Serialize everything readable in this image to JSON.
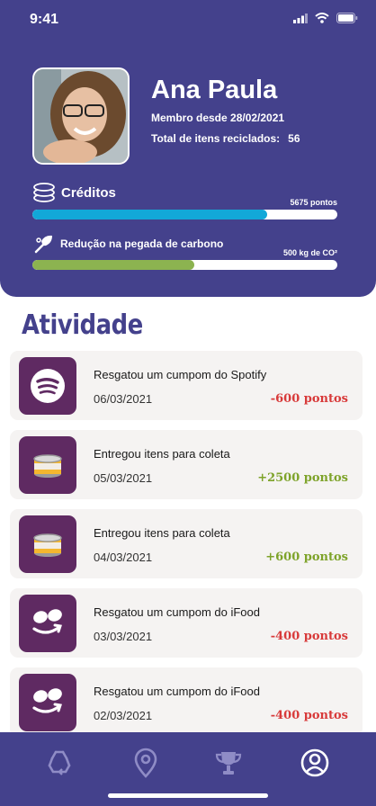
{
  "status_bar": {
    "time": "9:41",
    "icons": [
      "signal-icon",
      "wifi-icon",
      "battery-icon"
    ]
  },
  "profile": {
    "name": "Ana Paula",
    "member_since": "Membro desde 28/02/2021",
    "total_label": "Total de itens reciclados:",
    "total_value": "56"
  },
  "credits": {
    "label": "Créditos",
    "value": "5675 pontos",
    "progress_fraction": 0.77,
    "color": "#12a8d8"
  },
  "carbon": {
    "label": "Redução na pegada de carbono",
    "value": "500 kg de CO²",
    "progress_fraction": 0.53,
    "color": "#8cb350"
  },
  "activity": {
    "title": "Atividade",
    "items": [
      {
        "title": "Resgatou um cumpom do Spotify",
        "date": "06/03/2021",
        "points": "-600 pontos",
        "icon": "spotify-icon",
        "type": "negative"
      },
      {
        "title": "Entregou itens para coleta",
        "date": "05/03/2021",
        "points": "+2500 pontos",
        "icon": "can-icon",
        "type": "positive"
      },
      {
        "title": "Entregou itens para coleta",
        "date": "04/03/2021",
        "points": "+600 pontos",
        "icon": "can-icon",
        "type": "positive"
      },
      {
        "title": "Resgatou um cumpom do iFood",
        "date": "03/03/2021",
        "points": "-400 pontos",
        "icon": "ifood-icon",
        "type": "negative"
      },
      {
        "title": "Resgatou um cumpom do iFood",
        "date": "02/03/2021",
        "points": "-400 pontos",
        "icon": "ifood-icon",
        "type": "negative"
      }
    ]
  },
  "bottom_nav": {
    "items": [
      {
        "icon": "recycle-icon",
        "active": false
      },
      {
        "icon": "map-pin-icon",
        "active": false
      },
      {
        "icon": "trophy-icon",
        "active": false
      },
      {
        "icon": "profile-icon",
        "active": true
      }
    ]
  },
  "colors": {
    "primary": "#44418c",
    "icon_bg": "#5f2a62",
    "negative": "#d83a3a",
    "positive": "#7ea32a"
  }
}
